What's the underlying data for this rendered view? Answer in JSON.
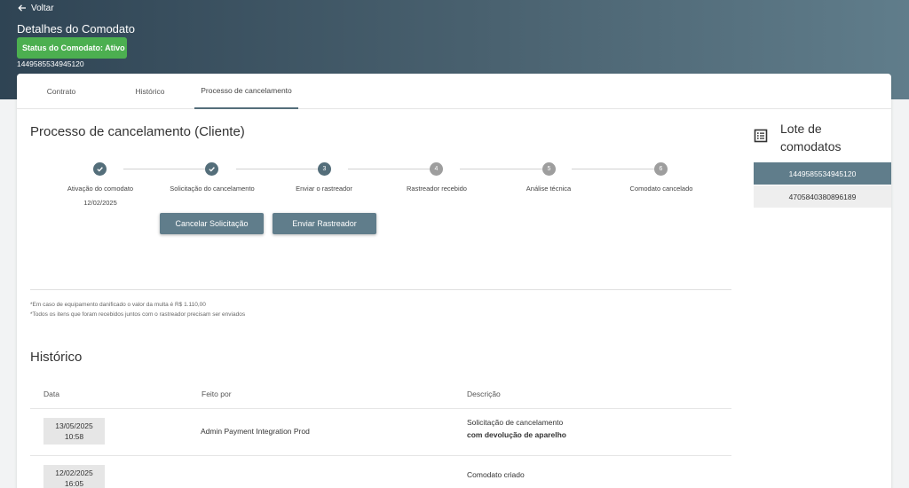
{
  "header": {
    "back_label": "Voltar",
    "title": "Detalhes do Comodato",
    "status": "Status do Comodato: Ativo",
    "id": "1449585534945120"
  },
  "tabs": [
    {
      "label": "Contrato"
    },
    {
      "label": "Histórico"
    },
    {
      "label": "Processo de cancelamento",
      "active": true
    }
  ],
  "process": {
    "title": "Processo de cancelamento (Cliente)",
    "steps": [
      {
        "number": "1",
        "label": "Ativação do comodato",
        "date": "12/02/2025",
        "state": "done"
      },
      {
        "number": "2",
        "label": "Solicitação do cancelamento",
        "date": "",
        "state": "done"
      },
      {
        "number": "3",
        "label": "Enviar o rastreador",
        "date": "",
        "state": "current"
      },
      {
        "number": "4",
        "label": "Rastreador recebido",
        "date": "",
        "state": "pending"
      },
      {
        "number": "5",
        "label": "Análise técnica",
        "date": "",
        "state": "pending"
      },
      {
        "number": "6",
        "label": "Comodato cancelado",
        "date": "",
        "state": "pending"
      }
    ],
    "cancel_button": "Cancelar Solicitação",
    "send_button": "Enviar Rastreador",
    "notes": [
      "*Em caso de equipamento danificado o valor da multa é R$ 1.110,00",
      "*Todos os itens que foram recebidos juntos com o rastreador precisam ser enviados"
    ]
  },
  "history": {
    "title": "Histórico",
    "columns": {
      "date": "Data",
      "by": "Feito por",
      "desc": "Descrição"
    },
    "rows": [
      {
        "date": "13/05/2025",
        "time": "10:58",
        "by": "Admin Payment Integration Prod",
        "desc": "Solicitação de cancelamento",
        "desc_bold": "com devolução de aparelho"
      },
      {
        "date": "12/02/2025",
        "time": "16:05",
        "by": "",
        "desc": "Comodato criado",
        "desc_bold": ""
      }
    ]
  },
  "sidebar": {
    "title_line1": "Lote de",
    "title_line2": "comodatos",
    "icon": "list-icon",
    "items": [
      {
        "id": "1449585534945120",
        "active": true
      },
      {
        "id": "4705840380896189",
        "active": false
      }
    ]
  },
  "colors": {
    "accent": "#607d8b",
    "status_green": "#4caf50",
    "header_dark": "#2f4454"
  }
}
